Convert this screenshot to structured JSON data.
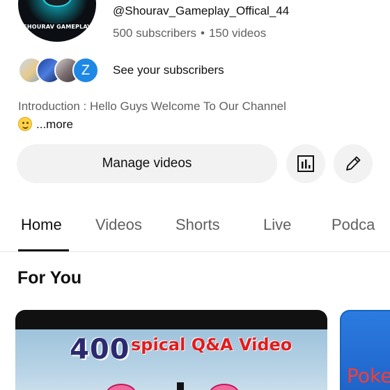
{
  "channel": {
    "avatar_text": "SHOURAV GAMEPLAY",
    "handle": "@Shourav_Gameplay_Offical_44",
    "subscribers": "500 subscribers",
    "separator": "•",
    "videos": "150 videos",
    "see_subscribers": "See your subscribers",
    "subscriber_avatar_letter": "Z",
    "introduction": "Introduction : Hello Guys Welcome To Our Channel",
    "more": "...more"
  },
  "actions": {
    "manage_videos": "Manage videos",
    "analytics_icon": "bar-chart-icon",
    "edit_icon": "pencil-icon"
  },
  "tabs": [
    {
      "label": "Home",
      "active": true
    },
    {
      "label": "Videos",
      "active": false
    },
    {
      "label": "Shorts",
      "active": false
    },
    {
      "label": "Live",
      "active": false
    },
    {
      "label": "Podca",
      "active": false
    }
  ],
  "section": {
    "title": "For You"
  },
  "videos": [
    {
      "thumb_number": "400",
      "thumb_title": "spical Q&A Video"
    },
    {
      "thumb_title": "Poke"
    }
  ],
  "colors": {
    "button_bg": "#f2f2f2",
    "secondary_text": "#606060",
    "primary_text": "#0f0f0f",
    "avatar_z_bg": "#1e88e5"
  }
}
